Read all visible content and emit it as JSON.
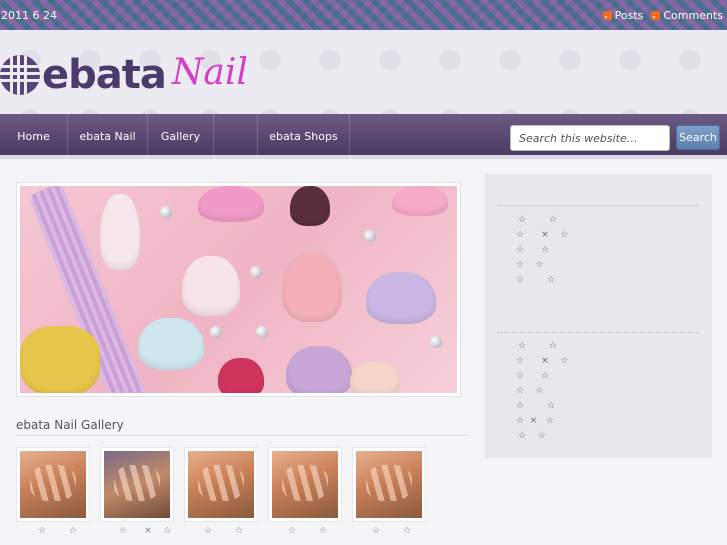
{
  "topbar": {
    "date": "2011 6 24",
    "posts_label": "Posts",
    "comments_label": "Comments"
  },
  "header": {
    "logo_text": "ebata",
    "logo_script": "Nail"
  },
  "nav": {
    "items": [
      "Home",
      "ebata Nail",
      "Gallery",
      "",
      "ebata Shops"
    ]
  },
  "search": {
    "placeholder": "Search this website…",
    "button_label": "Search"
  },
  "main": {
    "gallery_title": "ebata Nail Gallery",
    "thumb_captions": [
      "☆        ☆",
      "☆      ×    ☆",
      "☆        ☆",
      "☆        ☆",
      "☆        ☆"
    ]
  },
  "sidebar": {
    "block1": [
      "☆        ☆",
      "☆      ×    ☆",
      "☆      ☆",
      "☆    ☆",
      "☆        ☆"
    ],
    "block2": [
      "☆        ☆",
      "☆      ×    ☆",
      "☆      ☆",
      "☆    ☆",
      "☆        ☆",
      "☆  ×   ☆",
      "☆    ☆"
    ]
  },
  "colors": {
    "nav_bg": "#4a3b62",
    "logo_purple": "#4b3b6b",
    "logo_pink": "#d63ec8",
    "rss_orange": "#f26a21",
    "search_button": "#5b7fb0"
  },
  "icons": {
    "rss": "rss-icon",
    "logo_mark": "logo-mark-icon"
  }
}
